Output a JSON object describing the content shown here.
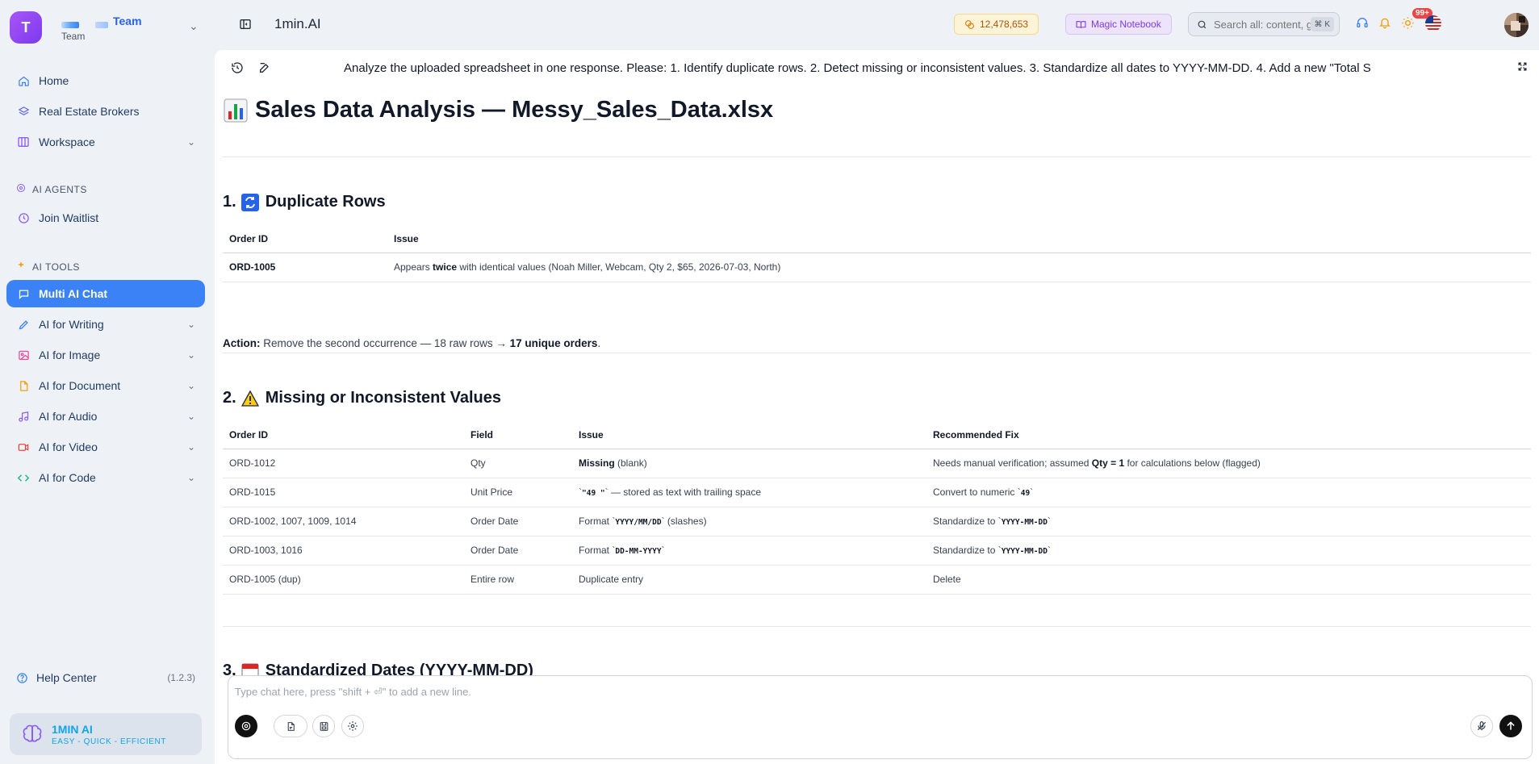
{
  "sidebar": {
    "team_initial": "T",
    "team_name": "Team",
    "team_sub": "Team",
    "nav": [
      {
        "label": "Home"
      },
      {
        "label": "Real Estate Brokers"
      },
      {
        "label": "Workspace"
      }
    ],
    "agents_section": "AI AGENTS",
    "join_waitlist": "Join Waitlist",
    "tools_section": "AI TOOLS",
    "tools": [
      {
        "label": "Multi AI Chat"
      },
      {
        "label": "AI for Writing"
      },
      {
        "label": "AI for Image"
      },
      {
        "label": "AI for Document"
      },
      {
        "label": "AI for Audio"
      },
      {
        "label": "AI for Video"
      },
      {
        "label": "AI for Code"
      }
    ],
    "help_center": "Help Center",
    "version": "(1.2.3)",
    "brand_title": "1MIN AI",
    "brand_tagline": "EASY - QUICK - EFFICIENT"
  },
  "topbar": {
    "app_title": "1min.AI",
    "credits": "12,478,653",
    "magic_notebook": "Magic Notebook",
    "search_placeholder": "Search all: content, guides",
    "search_shortcut": "⌘ K",
    "notifications_badge": "99+"
  },
  "chat": {
    "title": "Analyze the uploaded spreadsheet in one response. Please: 1. Identify duplicate rows. 2. Detect missing or inconsistent values. 3. Standardize all dates to YYYY-MM-DD. 4. Add a new \"Total S",
    "doc_title": "Sales Data Analysis — Messy_Sales_Data.xlsx",
    "section1": {
      "num": "1.",
      "title": "Duplicate Rows",
      "headers": [
        "Order ID",
        "Issue"
      ],
      "row": {
        "order_id": "ORD-1005",
        "issue_pre": "Appears ",
        "issue_bold": "twice",
        "issue_post": " with identical values (Noah Miller, Webcam, Qty 2, $65, 2026-07-03, North)"
      },
      "action_label": "Action:",
      "action_text": " Remove the second occurrence — 18 raw rows → ",
      "action_bold": "17 unique orders",
      "action_end": "."
    },
    "section2": {
      "num": "2.",
      "title": "Missing or Inconsistent Values",
      "headers": [
        "Order ID",
        "Field",
        "Issue",
        "Recommended Fix"
      ],
      "rows": [
        {
          "order_id": "ORD-1012",
          "field": "Qty",
          "issue_bold": "Missing",
          "issue_text": " (blank)",
          "fix_pre": "Needs manual verification; assumed ",
          "fix_bold": "Qty = 1",
          "fix_post": " for calculations below (flagged)"
        },
        {
          "order_id": "ORD-1015",
          "field": "Unit Price",
          "issue_code": "\"49 \"",
          "issue_text": " — stored as text with trailing space",
          "fix_pre": "Convert to numeric ",
          "fix_code": "49"
        },
        {
          "order_id": "ORD-1002, 1007, 1009, 1014",
          "field": "Order Date",
          "issue_pre": "Format ",
          "issue_code": "YYYY/MM/DD",
          "issue_text": " (slashes)",
          "fix_pre": "Standardize to ",
          "fix_code": "YYYY-MM-DD"
        },
        {
          "order_id": "ORD-1003, 1016",
          "field": "Order Date",
          "issue_pre": "Format ",
          "issue_code": "DD-MM-YYYY",
          "fix_pre": "Standardize to ",
          "fix_code": "YYYY-MM-DD"
        },
        {
          "order_id": "ORD-1005 (dup)",
          "field": "Entire row",
          "issue_text": "Duplicate entry",
          "fix_pre": "Delete"
        }
      ]
    },
    "section3": {
      "num": "3.",
      "title": "Standardized Dates (YYYY-MM-DD)"
    },
    "composer_placeholder": "Type chat here, press \"shift + ⏎\" to add a new line."
  },
  "colors": {
    "accent": "#3b82f6",
    "team_avatar": "#7c3aed",
    "credits_text": "#b45309",
    "notebook_text": "#7c3aed",
    "badge": "#ef4444"
  }
}
